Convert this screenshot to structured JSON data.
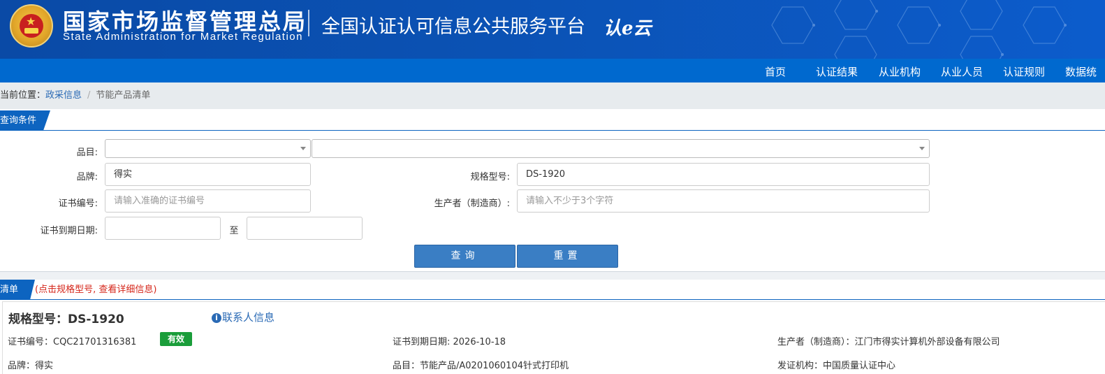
{
  "header": {
    "org_name_cn": "国家市场监督管理总局",
    "org_name_en": "State Administration  for  Market Regulation",
    "platform_title": "全国认证认可信息公共服务平台",
    "logo_text": "认e云"
  },
  "nav": {
    "items": [
      "首页",
      "认证结果",
      "从业机构",
      "从业人员",
      "认证规则",
      "数据统"
    ]
  },
  "breadcrumb": {
    "label": "当前位置：",
    "link": "政采信息",
    "separator": "/",
    "current": "节能产品清单"
  },
  "query_section": {
    "title": "查询条件"
  },
  "form": {
    "category_label": "品目:",
    "category_value": "",
    "subcategory_value": "",
    "brand_label": "品牌:",
    "brand_value": "得实",
    "model_label": "规格型号:",
    "model_value": "DS-1920",
    "cert_no_label": "证书编号:",
    "cert_no_placeholder": "请输入准确的证书编号",
    "manufacturer_label": "生产者（制造商）:",
    "manufacturer_placeholder": "请输入不少于3个字符",
    "expiry_label": "证书到期日期:",
    "expiry_from": "",
    "expiry_to_label": "至",
    "expiry_to": "",
    "search_button": "查询",
    "reset_button": "重置"
  },
  "list_section": {
    "title": "清单",
    "note": "(点击规格型号, 查看详细信息)"
  },
  "result": {
    "spec_label": "规格型号：",
    "spec_value": "DS-1920",
    "contact_link": "联系人信息",
    "contact_icon": "info-circle-icon",
    "cert_no_text": "证书编号：CQC21701316381",
    "status_badge": "有效",
    "status_color": "#1a9d3a",
    "expiry_text": "证书到期日期: 2026-10-18",
    "manufacturer_text": "生产者（制造商）：江门市得实计算机外部设备有限公司",
    "brand_text": "品牌：得实",
    "category_text": "品目：节能产品/A0201060104针式打印机",
    "issuer_text": "发证机构：中国质量认证中心"
  },
  "colors": {
    "header_blue": "#0b52b4",
    "nav_blue": "#0069cf",
    "link_blue": "#2a6ab5",
    "button_blue": "#3a7ec4",
    "note_red": "#d5261a"
  }
}
